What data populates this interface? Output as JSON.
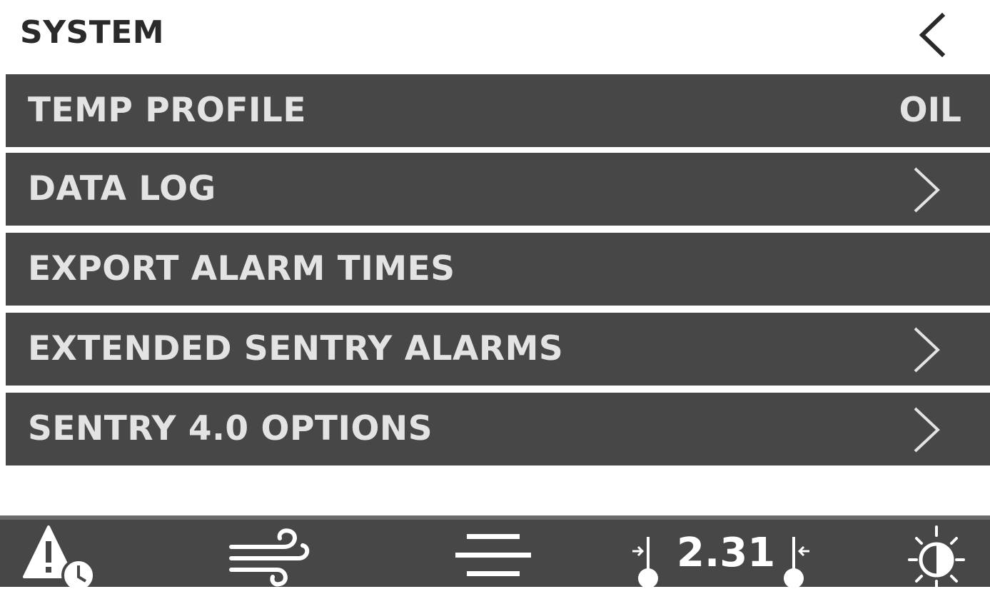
{
  "header": {
    "title": "SYSTEM",
    "back_icon": "chevron-left-icon"
  },
  "menu": {
    "items": [
      {
        "label": "TEMP PROFILE",
        "value": "OIL",
        "icon": ""
      },
      {
        "label": "DATA LOG",
        "value": "",
        "icon": "chevron-right-icon"
      },
      {
        "label": "EXPORT ALARM TIMES",
        "value": "",
        "icon": ""
      },
      {
        "label": "EXTENDED SENTRY ALARMS",
        "value": "",
        "icon": "chevron-right-icon"
      },
      {
        "label": "SENTRY 4.0 OPTIONS",
        "value": "",
        "icon": "chevron-right-icon"
      }
    ]
  },
  "bottom_bar": {
    "alarm_icon": "alarm-clock-warning-icon",
    "wind_icon": "wind-icon",
    "menu_icon": "hamburger-menu-icon",
    "calibration_value": "2.31",
    "brightness_icon": "brightness-contrast-icon"
  },
  "colors": {
    "background": "#ffffff",
    "menu_item_bg": "#474747",
    "menu_text": "#e3e3e3",
    "header_text": "#2a2a2a"
  }
}
